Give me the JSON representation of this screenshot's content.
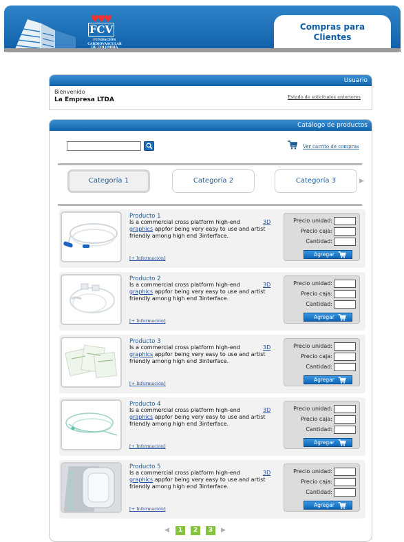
{
  "header": {
    "logo_text": "FCV",
    "logo_subtitle": [
      "FUNDACIÓN",
      "CARDIOVASCULAR",
      "DE COLOMBIA"
    ],
    "title_line1": "Compras para",
    "title_line2": "Clientes"
  },
  "user_panel": {
    "heading": "Usuario",
    "welcome": "Bienvenido",
    "company": "La Empresa LTDA",
    "history_link": "Estado de solicitudes anteriores"
  },
  "catalog": {
    "heading": "Catálogo de productos",
    "search_value": "",
    "cart_link": "Ver carrito de compras",
    "categories": [
      "Categoría 1",
      "Categoría 2",
      "Categoría 3"
    ],
    "active_category": "Categoría 1",
    "products": [
      {
        "name": "Producto 1",
        "desc_start": "Is a commercial cross platform high-end",
        "link_3d": "3D",
        "link_graphics": "graphics",
        "desc_rest": " appfor being very easy to use and artist friendly among high end 3interface.",
        "more": "[+ Información]"
      },
      {
        "name": "Producto 2",
        "desc_start": "Is a commercial cross platform high-end",
        "link_3d": "3D",
        "link_graphics": "graphics",
        "desc_rest": " appfor being very easy to use and artist friendly among high end 3interface.",
        "more": "[+ Información]"
      },
      {
        "name": "Producto 3",
        "desc_start": "Is a commercial cross platform high-end",
        "link_3d": "3D",
        "link_graphics": "graphics",
        "desc_rest": " appfor being very easy to use and artist friendly among high end 3interface.",
        "more": "[+ Información]"
      },
      {
        "name": "Producto 4",
        "desc_start": "Is a commercial cross platform high-end",
        "link_3d": "3D",
        "link_graphics": "graphics",
        "desc_rest": " appfor being very easy to use and artist friendly among high end 3interface.",
        "more": "[+ Información]"
      },
      {
        "name": "Producto 5",
        "desc_start": "Is a commercial cross platform high-end",
        "link_3d": "3D",
        "link_graphics": "graphics",
        "desc_rest": " appfor being very easy to use and artist friendly among high end 3interface.",
        "more": "[+ Información]"
      }
    ],
    "price_labels": {
      "unit": "Precio unidad:",
      "box": "Precio caja:",
      "qty": "Cantidad:"
    },
    "add_button": "Agregar",
    "pages": [
      "1",
      "2",
      "3"
    ]
  },
  "colors": {
    "brand_blue": "#0f5fa8",
    "page_green": "#86c33c"
  },
  "icons": [
    "building-graphic",
    "search-icon",
    "cart-icon",
    "chevron-right-icon",
    "chevron-left-icon"
  ]
}
